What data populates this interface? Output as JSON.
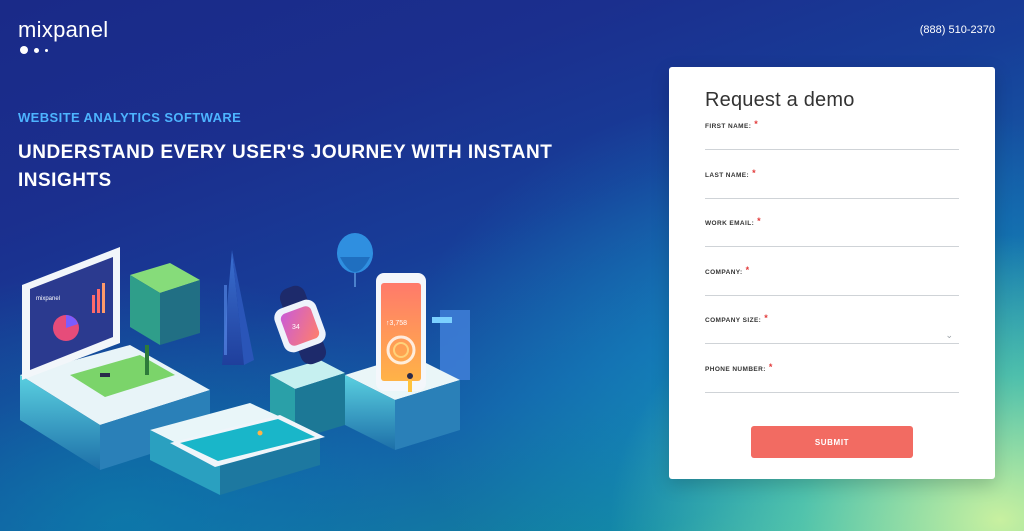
{
  "brand": {
    "name": "mixpanel",
    "phone": "(888) 510-2370"
  },
  "hero": {
    "eyebrow": "WEBSITE ANALYTICS SOFTWARE",
    "headline": "UNDERSTAND EVERY USER'S JOURNEY WITH INSTANT INSIGHTS"
  },
  "illustration": {
    "laptop_logo": "mixpanel",
    "phone_value": "↑3,758",
    "watch_value": "34",
    "icons": [
      "balloon-icon",
      "laptop-icon",
      "smartwatch-icon",
      "smartphone-icon",
      "tablet-icon",
      "city-icon"
    ]
  },
  "form": {
    "title": "Request a demo",
    "required_mark": "*",
    "fields": [
      {
        "label": "FIRST NAME:",
        "value": ""
      },
      {
        "label": "LAST NAME:",
        "value": ""
      },
      {
        "label": "WORK EMAIL:",
        "value": ""
      },
      {
        "label": "COMPANY:",
        "value": ""
      },
      {
        "label": "COMPANY SIZE:",
        "value": ""
      },
      {
        "label": "PHONE NUMBER:",
        "value": ""
      }
    ],
    "submit_label": "SUBMIT"
  },
  "colors": {
    "accent_blue": "#4db4ff",
    "submit": "#f26b62",
    "required": "#e23a3a"
  }
}
